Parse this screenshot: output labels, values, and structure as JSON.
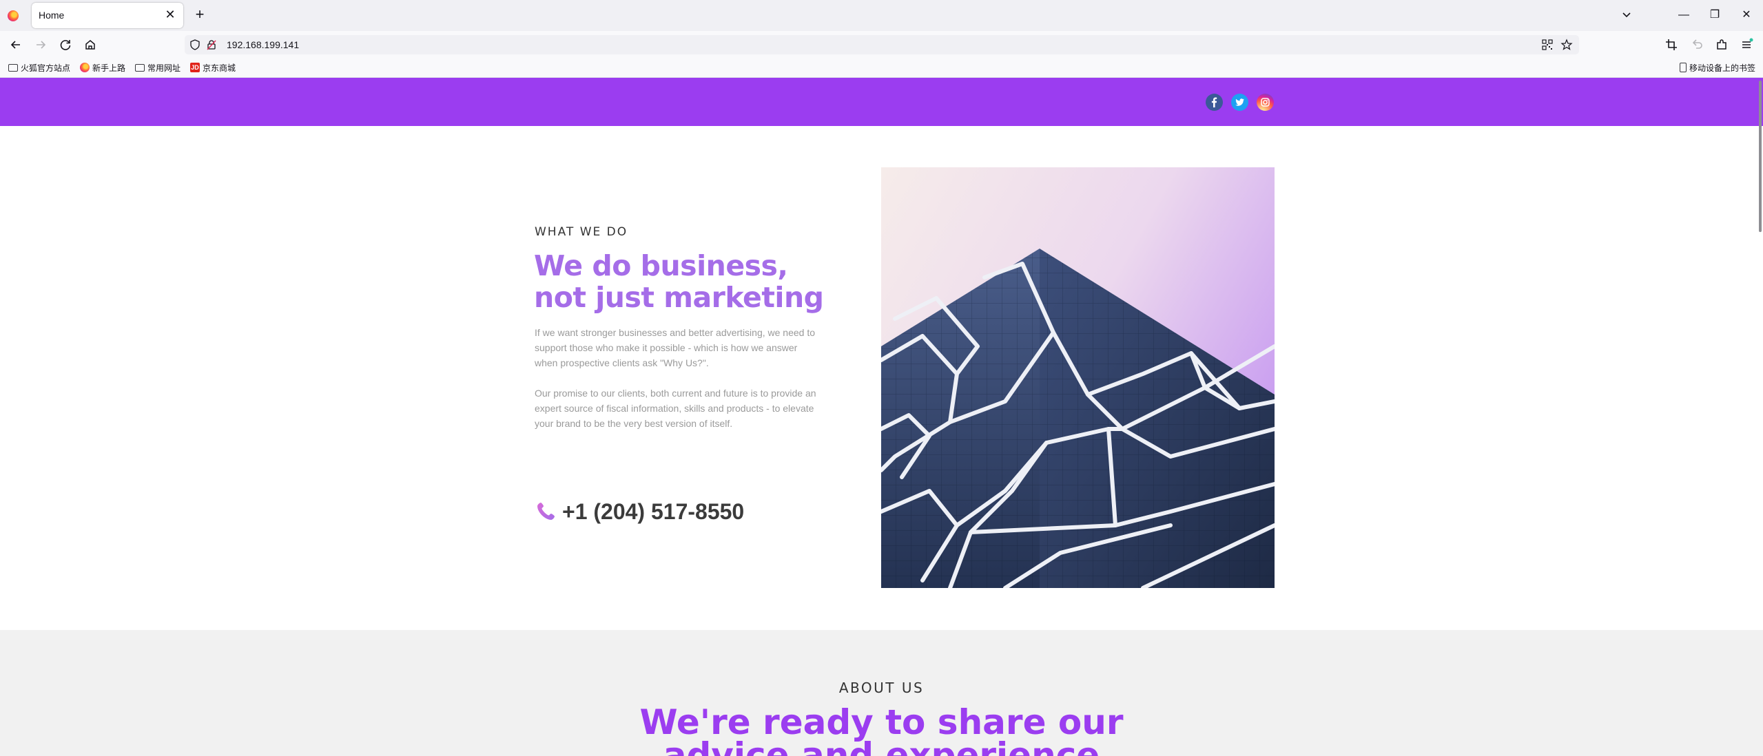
{
  "browser": {
    "tab_title": "Home",
    "tab_close": "✕",
    "new_tab": "+",
    "url": "192.168.199.141",
    "window_controls": {
      "minimize": "—",
      "restore": "❐",
      "close": "✕"
    },
    "bookmarks": [
      {
        "label": "火狐官方站点",
        "icon": "folder-icon"
      },
      {
        "label": "新手上路",
        "icon": "firefox-icon"
      },
      {
        "label": "常用网址",
        "icon": "folder-icon"
      },
      {
        "label": "京东商城",
        "icon": "jd-icon"
      }
    ],
    "mobile_bookmarks": "移动设备上的书签"
  },
  "header": {
    "social": [
      {
        "name": "facebook",
        "icon": "facebook-icon",
        "color": "#3b5998"
      },
      {
        "name": "twitter",
        "icon": "twitter-icon",
        "color": "#1da1f2"
      },
      {
        "name": "instagram",
        "icon": "instagram-icon",
        "color": "#d6249f"
      }
    ],
    "bar_color": "#9b3df0"
  },
  "what_we_do": {
    "eyebrow": "WHAT WE DO",
    "headline_line1": "We do business,",
    "headline_line2": "not just marketing",
    "paragraph1": "If we want stronger businesses and better advertising, we need to support those who make it possible - which is how we answer when prospective clients ask \"Why Us?\".",
    "paragraph2": "Our promise to our clients, both current and future is to provide an expert source of fiscal information, skills and products - to elevate your brand to be the very best version of itself.",
    "phone": "+1 (204) 517-8550",
    "accent_color": "#a56de8"
  },
  "about": {
    "eyebrow": "ABOUT US",
    "title_line1": "We're ready to share our",
    "title_line2": "advice and experience"
  }
}
